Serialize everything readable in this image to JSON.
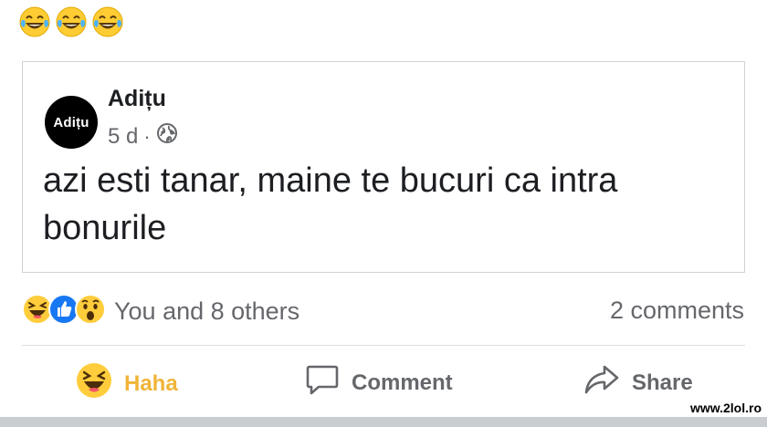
{
  "top_emojis": [
    "laughing-tears-emoji",
    "laughing-tears-emoji",
    "laughing-tears-emoji"
  ],
  "shared_post": {
    "avatar_text": "Adițu",
    "author": "Adițu",
    "time": "5 d",
    "separator": "·",
    "privacy_icon": "globe-icon",
    "text": "azi esti tanar, maine te bucuri ca intra bonurile"
  },
  "reactions": {
    "icons": [
      "haha-reaction-icon",
      "like-reaction-icon",
      "wow-reaction-icon"
    ],
    "text": "You and 8 others"
  },
  "comments_count": "2 comments",
  "actions": {
    "haha_label": "Haha",
    "comment_label": "Comment",
    "share_label": "Share"
  },
  "watermark": "www.2lol.ro",
  "colors": {
    "haha_active": "#f0b437",
    "secondary_text": "#65676b",
    "like_blue": "#1877f2"
  }
}
